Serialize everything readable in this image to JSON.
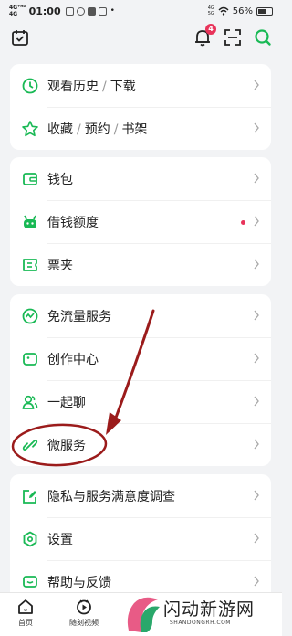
{
  "status": {
    "network": "4G⁺ᴴᴰ\n4G",
    "time": "01:00",
    "right_small": "4G\n5G",
    "battery": "56%"
  },
  "top": {
    "notification_count": "4"
  },
  "card1": {
    "history": "观看历史",
    "download": "下载",
    "favorites": "收藏",
    "reserve": "预约",
    "bookshelf": "书架"
  },
  "card2": {
    "wallet": "钱包",
    "credit": "借钱额度",
    "tickets": "票夹"
  },
  "card3": {
    "free_data": "免流量服务",
    "creator": "创作中心",
    "chat": "一起聊",
    "micro": "微服务"
  },
  "card4": {
    "survey": "隐私与服务满意度调查",
    "settings": "设置",
    "help": "帮助与反馈"
  },
  "nav": {
    "home": "首页",
    "video": "随刻视频"
  },
  "watermark": {
    "title": "闪动新游网",
    "sub": "SHANDONGRH.COM"
  },
  "colors": {
    "accent": "#19b955",
    "annotation": "#9b1b1b",
    "badge": "#e8335a"
  }
}
